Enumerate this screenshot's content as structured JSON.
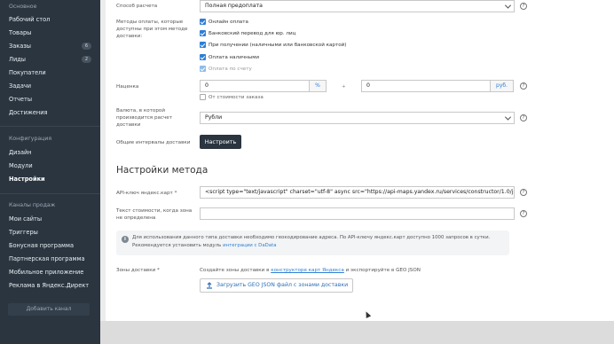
{
  "sidebar": {
    "section_main": "Основное",
    "items_main": [
      {
        "label": "Рабочий стол"
      },
      {
        "label": "Товары"
      },
      {
        "label": "Заказы",
        "badge": "6"
      },
      {
        "label": "Лиды",
        "badge": "2"
      },
      {
        "label": "Покупатели"
      },
      {
        "label": "Задачи"
      },
      {
        "label": "Отчеты"
      },
      {
        "label": "Достижения"
      }
    ],
    "section_config": "Конфигурация",
    "items_config": [
      {
        "label": "Дизайн"
      },
      {
        "label": "Модули"
      },
      {
        "label": "Настройки"
      }
    ],
    "section_channels": "Каналы продаж",
    "items_channels": [
      {
        "label": "Мои сайты"
      },
      {
        "label": "Триггеры"
      },
      {
        "label": "Бонусная программа"
      },
      {
        "label": "Партнерская программа"
      },
      {
        "label": "Мобильное приложение"
      },
      {
        "label": "Реклама в Яндекс.Директ"
      }
    ],
    "add_channel_label": "Добавить канал"
  },
  "form": {
    "payment_method_label": "Способ расчета",
    "payment_method_value": "Полная предоплата",
    "payment_options_label": "Методы оплаты, которые доступны при этом методе доставки:",
    "payment_options": [
      {
        "label": "Онлайн оплата",
        "state": "checked"
      },
      {
        "label": "Банковский перевод для юр. лиц",
        "state": "checked"
      },
      {
        "label": "При получении (наличными или банковской картой)",
        "state": "checked"
      },
      {
        "label": "Оплата наличными",
        "state": "checked"
      },
      {
        "label": "Оплата по счету",
        "state": "disabled"
      }
    ],
    "markup_label": "Наценка",
    "markup_percent_value": "0",
    "markup_percent_unit": "%",
    "markup_plus": "+",
    "markup_rub_value": "0",
    "markup_rub_unit": "руб.",
    "markup_from_order_label": "От стоимости заказа",
    "currency_label": "Валюта, в которой производится расчет доставки",
    "currency_value": "Рубли",
    "intervals_label": "Общие интервалы доставки",
    "intervals_button": "Настроить"
  },
  "method_settings": {
    "title": "Настройки метода",
    "api_key_label": "API-ключ яндекс.карт *",
    "api_key_value": "<script type=\"text/javascript\" charset=\"utf-8\" async src=\"https://api-maps.yandex.ru/services/constructor/1.0/js/?",
    "cost_text_label": "Текст стоимости, когда зона не определена",
    "cost_text_value": "",
    "info_icon": "i",
    "info_text_1": "Для использования данного типа доставки необходимо геокодирование адреса. По API-ключу яндекс.карт доступно 1000 запросов в сутки.",
    "info_text_2_prefix": "Рекомендуется установить модуль ",
    "info_text_2_link": "интеграции с DaData",
    "zones_label": "Зоны доставки *",
    "zones_hint_prefix": "Создайте зоны доставки в ",
    "zones_hint_link": "конструкторе карт Яндекса",
    "zones_hint_suffix": " и экспортируйте в GEO JSON",
    "upload_button": "Загрузить GEO JSON файл с зонами доставки"
  },
  "help_icon": "?",
  "colors": {
    "sidebar_bg": "#2a3540",
    "accent": "#2e7fd6",
    "button_dark": "#2a3540"
  }
}
